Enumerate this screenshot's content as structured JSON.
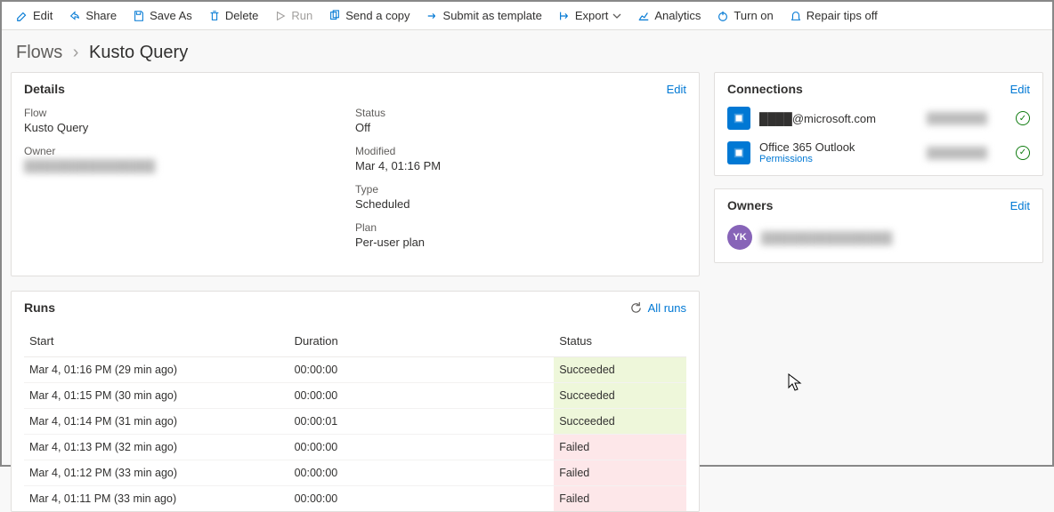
{
  "toolbar": {
    "edit": "Edit",
    "share": "Share",
    "save_as": "Save As",
    "delete": "Delete",
    "run": "Run",
    "send_copy": "Send a copy",
    "submit_template": "Submit as template",
    "export": "Export",
    "analytics": "Analytics",
    "turn_on": "Turn on",
    "repair_tips": "Repair tips off"
  },
  "breadcrumb": {
    "root": "Flows",
    "current": "Kusto Query"
  },
  "details": {
    "title": "Details",
    "edit": "Edit",
    "flow_label": "Flow",
    "flow_value": "Kusto Query",
    "owner_label": "Owner",
    "owner_value": "████████████████",
    "status_label": "Status",
    "status_value": "Off",
    "modified_label": "Modified",
    "modified_value": "Mar 4, 01:16 PM",
    "type_label": "Type",
    "type_value": "Scheduled",
    "plan_label": "Plan",
    "plan_value": "Per-user plan"
  },
  "runs": {
    "title": "Runs",
    "all_runs": "All runs",
    "columns": {
      "start": "Start",
      "duration": "Duration",
      "status": "Status"
    },
    "rows": [
      {
        "start": "Mar 4, 01:16 PM (29 min ago)",
        "duration": "00:00:00",
        "status": "Succeeded",
        "state": "success"
      },
      {
        "start": "Mar 4, 01:15 PM (30 min ago)",
        "duration": "00:00:00",
        "status": "Succeeded",
        "state": "success"
      },
      {
        "start": "Mar 4, 01:14 PM (31 min ago)",
        "duration": "00:00:01",
        "status": "Succeeded",
        "state": "success"
      },
      {
        "start": "Mar 4, 01:13 PM (32 min ago)",
        "duration": "00:00:00",
        "status": "Failed",
        "state": "failed"
      },
      {
        "start": "Mar 4, 01:12 PM (33 min ago)",
        "duration": "00:00:00",
        "status": "Failed",
        "state": "failed"
      },
      {
        "start": "Mar 4, 01:11 PM (33 min ago)",
        "duration": "00:00:00",
        "status": "Failed",
        "state": "failed"
      }
    ]
  },
  "connections": {
    "title": "Connections",
    "edit": "Edit",
    "items": [
      {
        "name": "████@microsoft.com",
        "sub": "",
        "icon": "kusto"
      },
      {
        "name": "Office 365 Outlook",
        "sub": "Permissions",
        "icon": "outlook"
      }
    ]
  },
  "owners": {
    "title": "Owners",
    "edit": "Edit",
    "avatar_initials": "YK",
    "owner_name": "████████████████"
  }
}
